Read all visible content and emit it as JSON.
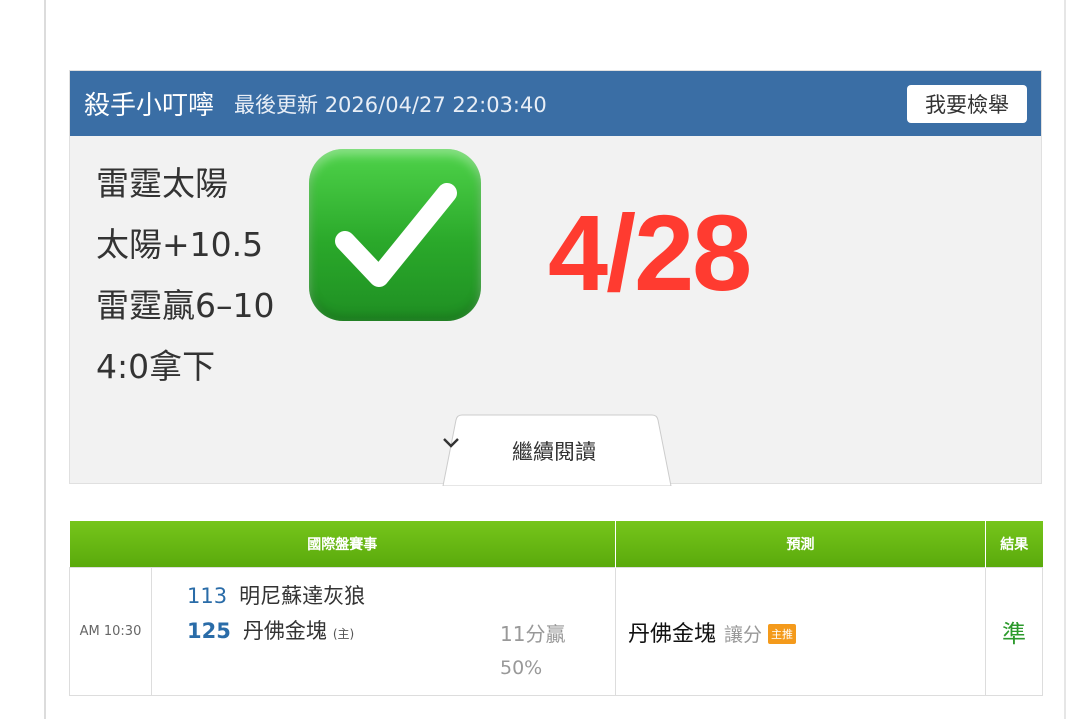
{
  "post": {
    "author": "殺手小叮嚀",
    "updated_text": "最後更新 2026/04/27 22:03:40",
    "report_button": "我要檢舉",
    "lines": [
      "雷霆太陽",
      "太陽+10.5",
      "雷霆贏6–10",
      "4:0拿下"
    ],
    "check_icon": "white-heavy-check-mark-icon",
    "date_text": "4/28",
    "date_color": "#ff3b30",
    "read_more": "繼續閱讀",
    "read_more_icon": "chevron-down-icon"
  },
  "table": {
    "headers": {
      "event": "國際盤賽事",
      "prediction": "預測",
      "result": "結果"
    },
    "row": {
      "time": "AM 10:30",
      "away_num": "113",
      "away_team": "明尼蘇達灰狼",
      "home_num": "125",
      "home_team": "丹佛金塊",
      "home_mark": "(主)",
      "margin": "11分贏",
      "percent": "50%",
      "pick_team": "丹佛金塊",
      "pick_type": "讓分",
      "badge": "主推",
      "result": "準"
    }
  },
  "colors": {
    "header_blue": "#3a6ea5",
    "table_green": "#5aaa0c",
    "accent_red": "#ff3b30",
    "result_green": "#2c9a2c"
  }
}
